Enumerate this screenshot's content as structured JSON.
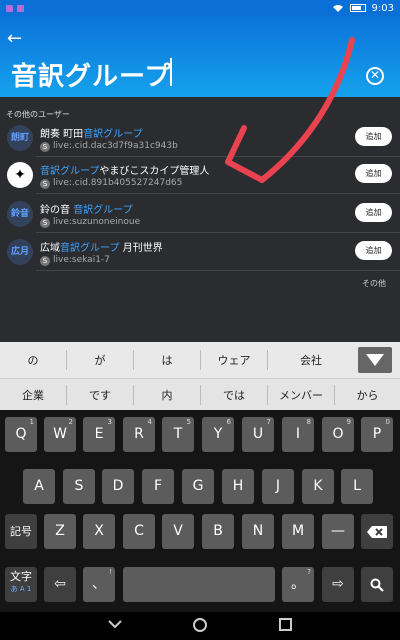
{
  "status": {
    "time": "9:03"
  },
  "header": {
    "search_text": "音訳グループ"
  },
  "results": {
    "section_label": "その他のユーザー",
    "more_label": "その他",
    "add_label": "追加",
    "users": [
      {
        "avatar": "朗町",
        "name_pre": "朗奏 町田",
        "name_hl": "音訳グループ",
        "name_post": "",
        "id": "live:.cid.dac3d7f9a31c943b"
      },
      {
        "avatar": "✦",
        "name_pre": "",
        "name_hl": "音訳グループ",
        "name_post": "やまびこスカイプ管理人",
        "id": "live:.cid.891b405527247d65"
      },
      {
        "avatar": "鈴音",
        "name_pre": "鈴の音 ",
        "name_hl": "音訳グループ",
        "name_post": "",
        "id": "live:suzunoneinoue"
      },
      {
        "avatar": "広月",
        "name_pre": "広域",
        "name_hl": "音訳グループ",
        "name_post": " 月刊世界",
        "id": "live:sekai1-7"
      }
    ]
  },
  "suggestions": {
    "row1": [
      "の",
      "が",
      "は",
      "ウェア",
      "会社"
    ],
    "row2": [
      "企業",
      "です",
      "内",
      "では",
      "メンバー",
      "から"
    ]
  },
  "keyboard": {
    "row1": [
      [
        "Q",
        "1"
      ],
      [
        "W",
        "2"
      ],
      [
        "E",
        "3"
      ],
      [
        "R",
        "4"
      ],
      [
        "T",
        "5"
      ],
      [
        "Y",
        "6"
      ],
      [
        "U",
        "7"
      ],
      [
        "I",
        "8"
      ],
      [
        "O",
        "9"
      ],
      [
        "P",
        "0"
      ]
    ],
    "row2": [
      "A",
      "S",
      "D",
      "F",
      "G",
      "H",
      "J",
      "K",
      "L"
    ],
    "row3": [
      "Z",
      "X",
      "C",
      "V",
      "B",
      "N",
      "M",
      "—"
    ],
    "symbols_label": "記号",
    "mode_label": "文字",
    "mode_sub": "あ A 1",
    "comma_label": "、",
    "comma_sup": "!",
    "period_label": "。",
    "period_sup": "?"
  },
  "colors": {
    "header": "#0b73da",
    "highlight": "#3ea5ff",
    "annotation": "#e8434f"
  },
  "icons": {
    "back": "arrow-left-icon",
    "clear": "clear-circle-icon",
    "skype": "skype-icon"
  }
}
